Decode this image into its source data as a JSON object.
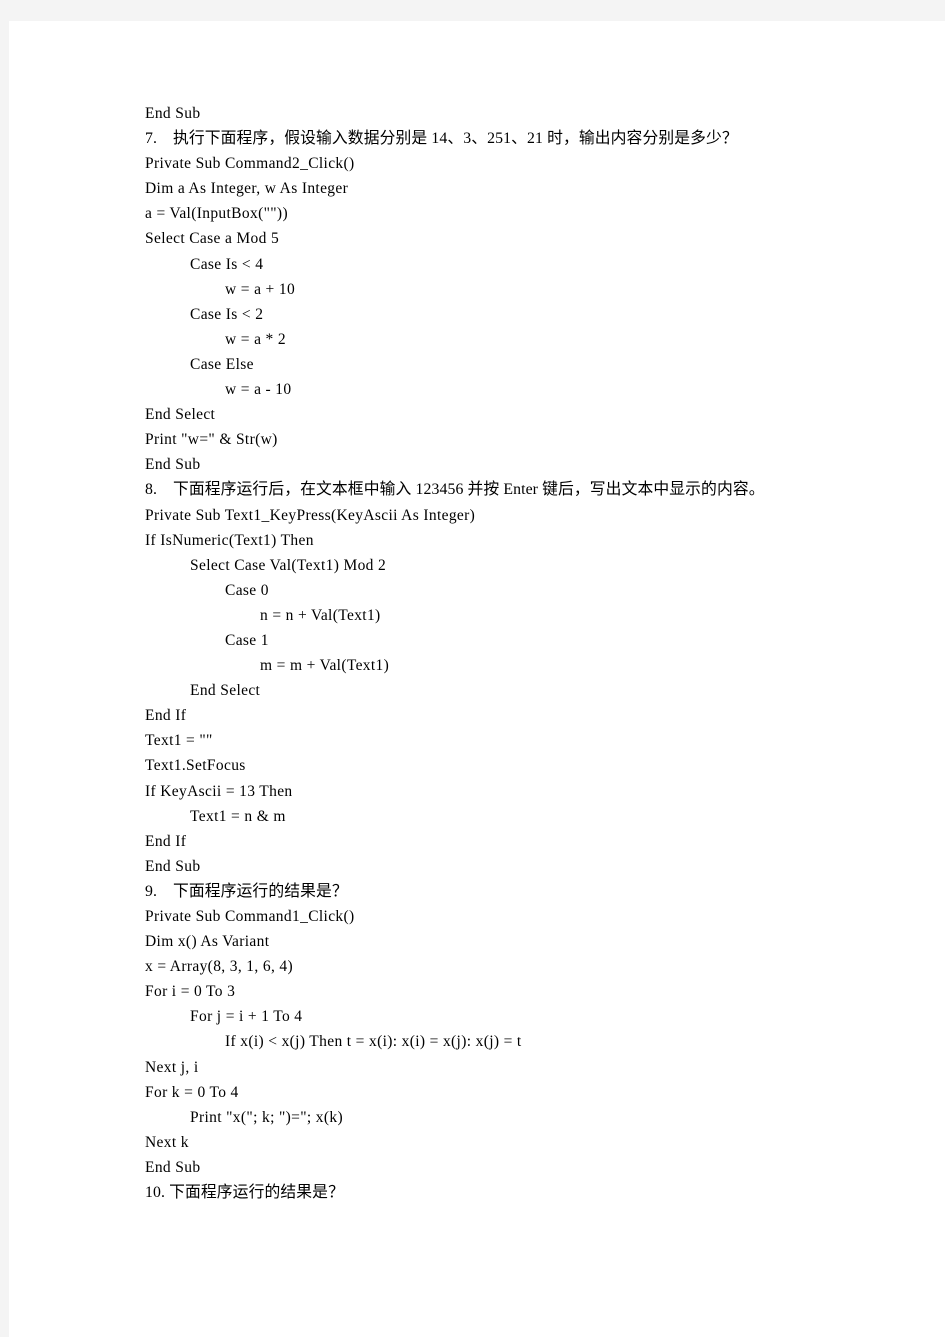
{
  "document": {
    "page_background": "#f4f4f4",
    "sheet_background": "#ffffff",
    "text_color": "#000000",
    "lines": [
      {
        "text": "End Sub",
        "indent": 0,
        "cn": false
      },
      {
        "text": "7.　执行下面程序，假设输入数据分别是 14、3、251、21 时，输出内容分别是多少？",
        "indent": 0,
        "cn": true
      },
      {
        "text": "Private Sub Command2_Click()",
        "indent": 0,
        "cn": false
      },
      {
        "text": "Dim a As Integer, w As Integer",
        "indent": 0,
        "cn": false
      },
      {
        "text": "a = Val(InputBox(\"\"))",
        "indent": 0,
        "cn": false
      },
      {
        "text": "Select Case a Mod 5",
        "indent": 0,
        "cn": false
      },
      {
        "text": "Case Is < 4",
        "indent": 1,
        "cn": false
      },
      {
        "text": "w = a + 10",
        "indent": 2,
        "cn": false
      },
      {
        "text": "Case Is < 2",
        "indent": 1,
        "cn": false
      },
      {
        "text": "w = a * 2",
        "indent": 2,
        "cn": false
      },
      {
        "text": "Case Else",
        "indent": 1,
        "cn": false
      },
      {
        "text": "w = a - 10",
        "indent": 2,
        "cn": false
      },
      {
        "text": "End Select",
        "indent": 0,
        "cn": false
      },
      {
        "text": "Print \"w=\" & Str(w)",
        "indent": 0,
        "cn": false
      },
      {
        "text": "End Sub",
        "indent": 0,
        "cn": false
      },
      {
        "text": "8.　下面程序运行后，在文本框中输入 123456 并按 Enter 键后，写出文本中显示的内容。",
        "indent": 0,
        "cn": true
      },
      {
        "text": "Private Sub Text1_KeyPress(KeyAscii As Integer)",
        "indent": 0,
        "cn": false
      },
      {
        "text": "If IsNumeric(Text1) Then",
        "indent": 0,
        "cn": false
      },
      {
        "text": "Select Case Val(Text1) Mod 2",
        "indent": 1,
        "cn": false
      },
      {
        "text": "Case 0",
        "indent": 2,
        "cn": false
      },
      {
        "text": "n = n + Val(Text1)",
        "indent": 3,
        "cn": false
      },
      {
        "text": "Case 1",
        "indent": 2,
        "cn": false
      },
      {
        "text": "m = m + Val(Text1)",
        "indent": 3,
        "cn": false
      },
      {
        "text": "End Select",
        "indent": 1,
        "cn": false
      },
      {
        "text": "End If",
        "indent": 0,
        "cn": false
      },
      {
        "text": "Text1 = \"\"",
        "indent": 0,
        "cn": false
      },
      {
        "text": "Text1.SetFocus",
        "indent": 0,
        "cn": false
      },
      {
        "text": "If KeyAscii = 13 Then",
        "indent": 0,
        "cn": false
      },
      {
        "text": "Text1 = n & m",
        "indent": 1,
        "cn": false
      },
      {
        "text": "End If",
        "indent": 0,
        "cn": false
      },
      {
        "text": "End Sub",
        "indent": 0,
        "cn": false
      },
      {
        "text": "9.　下面程序运行的结果是？",
        "indent": 0,
        "cn": true
      },
      {
        "text": "Private Sub Command1_Click()",
        "indent": 0,
        "cn": false
      },
      {
        "text": "Dim x() As Variant",
        "indent": 0,
        "cn": false
      },
      {
        "text": "x = Array(8, 3, 1, 6, 4)",
        "indent": 0,
        "cn": false
      },
      {
        "text": "For i = 0 To 3",
        "indent": 0,
        "cn": false
      },
      {
        "text": "For j = i + 1 To 4",
        "indent": 1,
        "cn": false
      },
      {
        "text": "If x(i) < x(j) Then t = x(i): x(i) = x(j): x(j) = t",
        "indent": 2,
        "cn": false
      },
      {
        "text": "Next j, i",
        "indent": 0,
        "cn": false
      },
      {
        "text": "For k = 0 To 4",
        "indent": 0,
        "cn": false
      },
      {
        "text": "Print \"x(\"; k; \")=\"; x(k)",
        "indent": 1,
        "cn": false
      },
      {
        "text": "Next k",
        "indent": 0,
        "cn": false
      },
      {
        "text": "End Sub",
        "indent": 0,
        "cn": false
      },
      {
        "text": "10. 下面程序运行的结果是？",
        "indent": 0,
        "cn": true
      }
    ]
  }
}
